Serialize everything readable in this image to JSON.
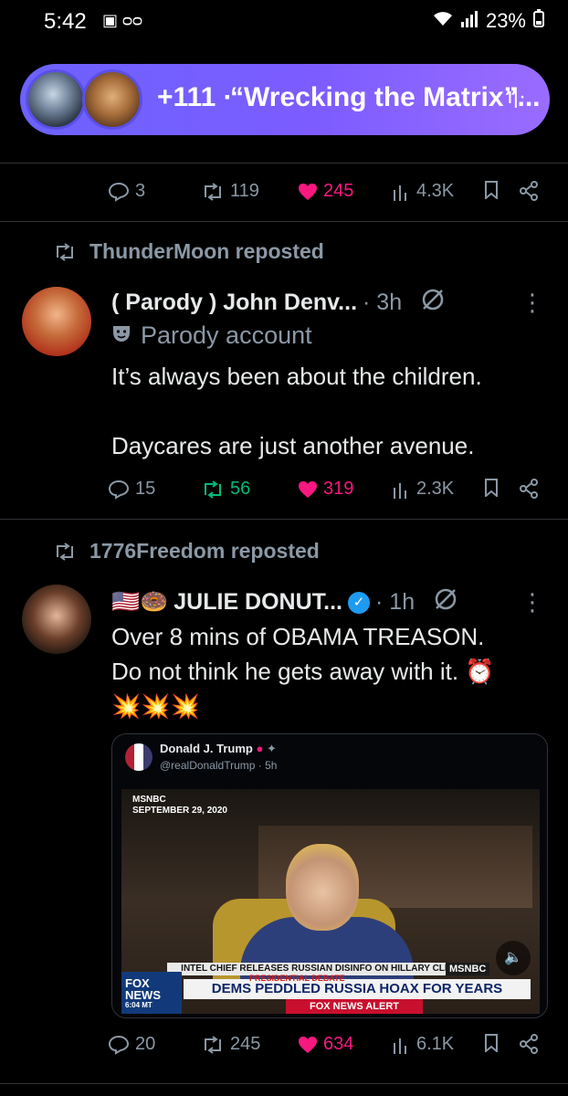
{
  "status_bar": {
    "time": "5:42",
    "battery": "23%"
  },
  "spaces": {
    "count": "+111",
    "separator": "·",
    "title": "“Wrecking the Matrix”..."
  },
  "top_actions": {
    "replies": "3",
    "reposts": "119",
    "likes": "245",
    "views": "4.3K"
  },
  "posts": [
    {
      "reposted_by": "ThunderMoon reposted",
      "name": "( Parody ) John Denv...",
      "time": "· 3h",
      "label": "Parody account",
      "text": "It’s always been about the children.\n\nDaycares are just another avenue.",
      "replies": "15",
      "reposts": "56",
      "likes": "319",
      "views": "2.3K"
    },
    {
      "reposted_by": "1776Freedom reposted",
      "name": "JULIE DONUT...",
      "time": "· 1h",
      "text": "Over 8 mins of OBAMA TREASON.\nDo not think he gets away with it. ⏰\n💥💥💥",
      "quote": {
        "name": "Donald J. Trump",
        "handle": "@realDonaldTrump · 5h",
        "video": {
          "tag": "MSNBC\nSEPTEMBER 29, 2020",
          "chyron_top": "INTEL CHIEF RELEASES RUSSIAN DISINFO ON HILLARY CLINTON",
          "network": "MSNBC",
          "debate": "PRESIDENTIAL DEBATE",
          "chyron_main": "DEMS PEDDLED RUSSIA HOAX FOR YEARS",
          "fox": "FOX\nNEWS",
          "fox_time": "6:04 MT",
          "alert": "FOX NEWS ALERT"
        }
      },
      "replies": "20",
      "reposts": "245",
      "likes": "634",
      "views": "6.1K"
    }
  ],
  "colors": {
    "like": "#f91880",
    "repost_active": "#00ba7c",
    "muted": "#8b98a5",
    "spaces_pill": "#7b5cff"
  }
}
